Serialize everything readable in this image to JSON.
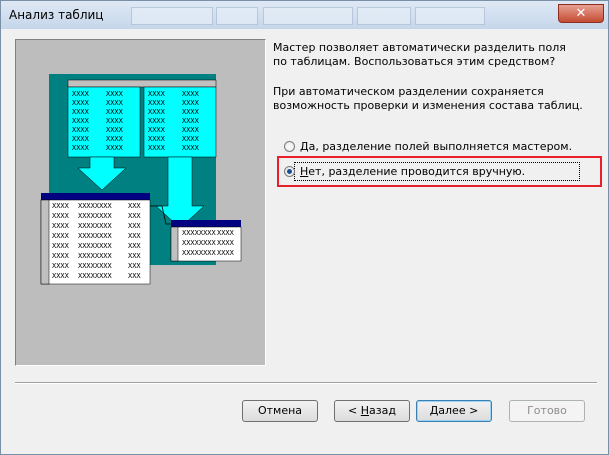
{
  "window": {
    "title": "Анализ таблиц"
  },
  "description": {
    "para1": "Мастер позволяет автоматически разделить поля по таблицам. Воспользоваться этим средством?",
    "para2": "При автоматическом разделении сохраняется возможность проверки и изменения состава таблиц."
  },
  "options": [
    {
      "accel": "Д",
      "rest": "а, разделение полей выполняется мастером.",
      "checked": false
    },
    {
      "accel": "Н",
      "rest": "ет, разделение проводится вручную.",
      "checked": true
    }
  ],
  "illustration": {
    "cell_text": "XXXX",
    "long_cell_text": "XXXXXXXX",
    "colors": {
      "cyan": "#00ffff",
      "teal": "#008080",
      "navy": "#000080",
      "gray": "#c0c0c0"
    }
  },
  "buttons": {
    "cancel": "Отмена",
    "back_accel": "Н",
    "back_rest": "азад",
    "back_prefix": "< ",
    "next_accel": "Д",
    "next_rest": "алее",
    "next_suffix": " >",
    "finish": "Готово"
  },
  "annotation": {
    "highlight_color": "#e8202a"
  }
}
